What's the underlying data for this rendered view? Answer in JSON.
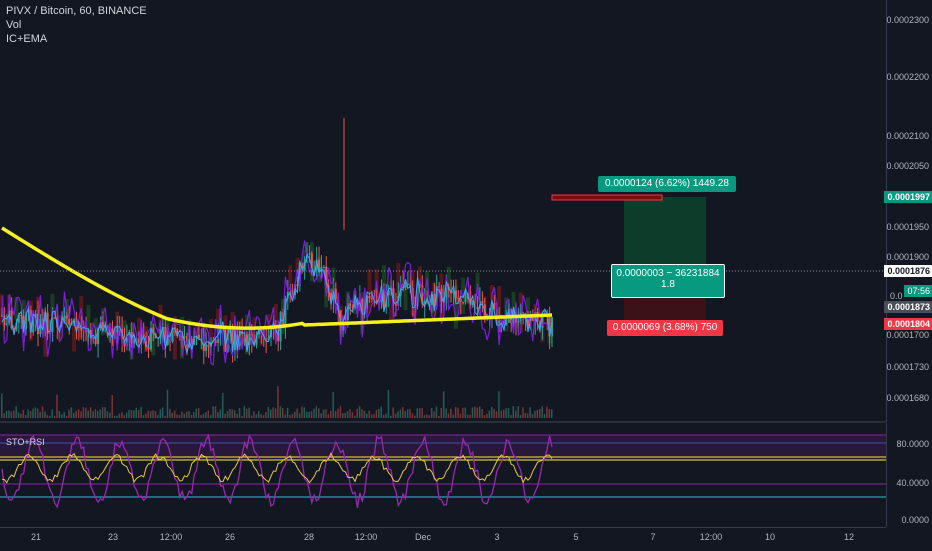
{
  "header": {
    "symbol": "PIVX / Bitcoin, 60, BINANCE",
    "vol": "Vol",
    "indicator": "IC+EMA"
  },
  "price_axis": {
    "ticks": [
      "0.0002300",
      "0.0002200",
      "0.0002100",
      "0.0002050",
      "0.0001950",
      "0.0001900",
      "0.0001730",
      "0.0001680"
    ],
    "tag_current": "0.0001876",
    "tag_time": "07:56",
    "tag_mid": "0.0001873",
    "tag_stop": "0.0001804",
    "tag_target": "0.0001997",
    "partial_1": "0.0",
    "partial_2": "0.0001700"
  },
  "rsi_pane": {
    "title": "STO+RSI",
    "ticks": [
      "80.0000",
      "40.0000",
      "0.0000"
    ]
  },
  "time_axis": {
    "ticks": [
      "21",
      "23",
      "12:00",
      "26",
      "28",
      "12:00",
      "Dec",
      "3",
      "5",
      "7",
      "12:00",
      "10",
      "12"
    ]
  },
  "position": {
    "target_label": "0.0000124 (6.62%) 1449.28",
    "mid_label": "0.0000003 ~ 36231884",
    "ratio": "1.8",
    "stop_label": "0.0000069 (3.68%) 750"
  },
  "colors": {
    "background": "#131722",
    "ema": "#f5f020",
    "rsi": "#9c27b0",
    "sto": "#e8c547",
    "target": "#089981",
    "stop": "#f23645",
    "up": "#26a69a",
    "down": "#ef5350"
  }
}
